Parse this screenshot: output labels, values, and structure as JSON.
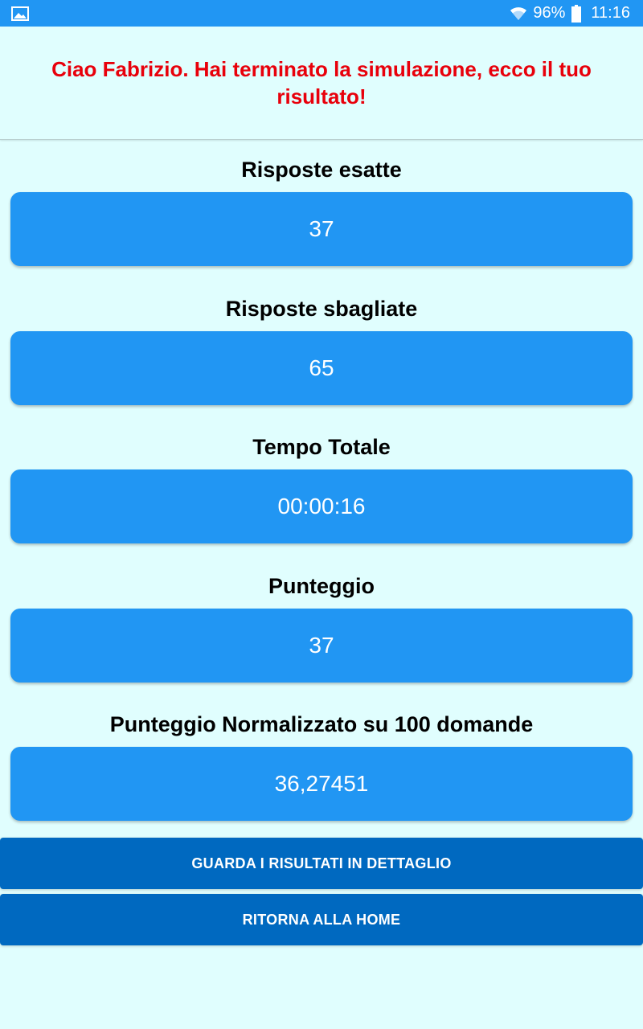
{
  "status_bar": {
    "battery": "96%",
    "time": "11:16",
    "icons": [
      "gallery-icon",
      "wifi-icon",
      "battery-icon"
    ]
  },
  "header": {
    "greeting": "Ciao Fabrizio. Hai terminato la simulazione, ecco il tuo risultato!"
  },
  "results": [
    {
      "label": "Risposte esatte",
      "value": "37"
    },
    {
      "label": "Risposte sbagliate",
      "value": "65"
    },
    {
      "label": "Tempo Totale",
      "value": "00:00:16"
    },
    {
      "label": "Punteggio",
      "value": "37"
    },
    {
      "label": "Punteggio Normalizzato su 100 domande",
      "value": "36,27451"
    }
  ],
  "buttons": {
    "details": "GUARDA I RISULTATI IN DETTAGLIO",
    "home": "RITORNA ALLA HOME"
  },
  "colors": {
    "background": "#e0fefe",
    "status_bar": "#2196f3",
    "card": "#2196f3",
    "button": "#0069c0",
    "greeting": "#e8000b"
  }
}
